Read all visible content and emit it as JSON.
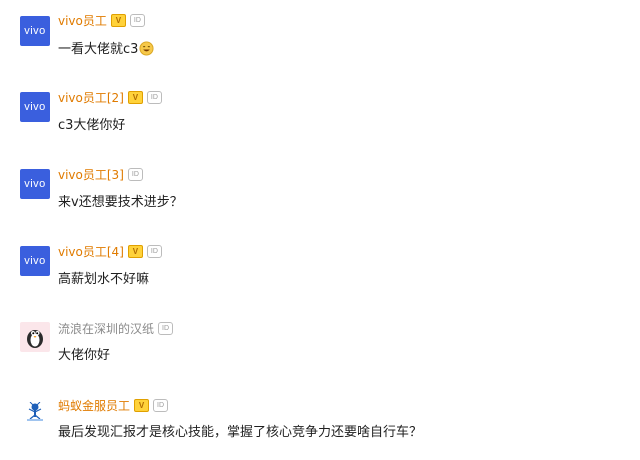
{
  "comments": [
    {
      "name": "vivo员工",
      "avatar_text": "vivo",
      "text": "一看大佬就c3",
      "emoji": "grinning-emoji"
    },
    {
      "name": "vivo员工[2]",
      "avatar_text": "vivo",
      "text": "c3大佬你好"
    },
    {
      "name": "vivo员工[3]",
      "avatar_text": "vivo",
      "text": "来v还想要技术进步？"
    },
    {
      "name": "vivo员工[4]",
      "avatar_text": "vivo",
      "text": "高薪划水不好嘛"
    },
    {
      "name": "流浪在深圳的汉纸",
      "text": "大佬你好"
    },
    {
      "name": "蚂蚁金服员工",
      "text": "最后发现汇报才是核心技能，掌握了核心竞争力还要啥自行车？"
    }
  ],
  "badges": {
    "v": "V",
    "id": "ID"
  },
  "colors": {
    "vivo_blue": "#3a5fde",
    "orange_name": "#e07b00",
    "gray_name": "#8a8a8a"
  }
}
